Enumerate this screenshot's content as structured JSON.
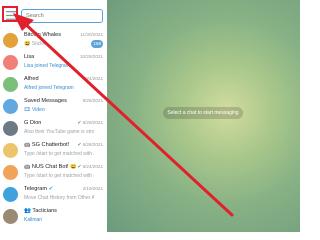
{
  "search": {
    "placeholder": "Search"
  },
  "chats": [
    {
      "name": "Bitcoin Whales",
      "date": "11/30/2021",
      "preview": "Sticker",
      "badge": "168",
      "preview_link": false
    },
    {
      "name": "Lisa",
      "date": "10/25/2021",
      "preview": "Lisa joined Telegram",
      "badge": "",
      "preview_link": true
    },
    {
      "name": "Alfred",
      "date": "10/4/2021",
      "preview": "Alfred joined Telegram",
      "badge": "",
      "preview_link": true
    },
    {
      "name": "Saved Messages",
      "date": "9/25/2021",
      "preview": "Video",
      "badge": "",
      "preview_link": true
    },
    {
      "name": "G Dion",
      "date": "8/29/2021",
      "preview": "Also their YouTube game is strong",
      "badge": "",
      "preview_link": false,
      "check": "✔"
    },
    {
      "name": "SG Chatterbot!",
      "date": "6/26/2021",
      "preview": "Type /start to get matched with a...",
      "badge": "",
      "preview_link": false,
      "check": "✔"
    },
    {
      "name": "NUS Chat Bot!",
      "date": "6/24/2021",
      "preview": "Type /start to get matched with a...",
      "badge": "",
      "preview_link": false,
      "check": "✔"
    },
    {
      "name": "Telegram",
      "date": "2/19/2021",
      "preview": "Move Chat History from Other Apps",
      "badge": "",
      "preview_link": false
    },
    {
      "name": "Tacticians",
      "date": "",
      "preview": "Kallman",
      "badge": "",
      "preview_link": true
    }
  ],
  "main": {
    "empty_state": "Select a chat to start messaging"
  },
  "icons": {
    "menu": "hamburger-menu-icon"
  },
  "colors": {
    "accent": "#5aa2d6",
    "annotation": "#e0212b"
  }
}
